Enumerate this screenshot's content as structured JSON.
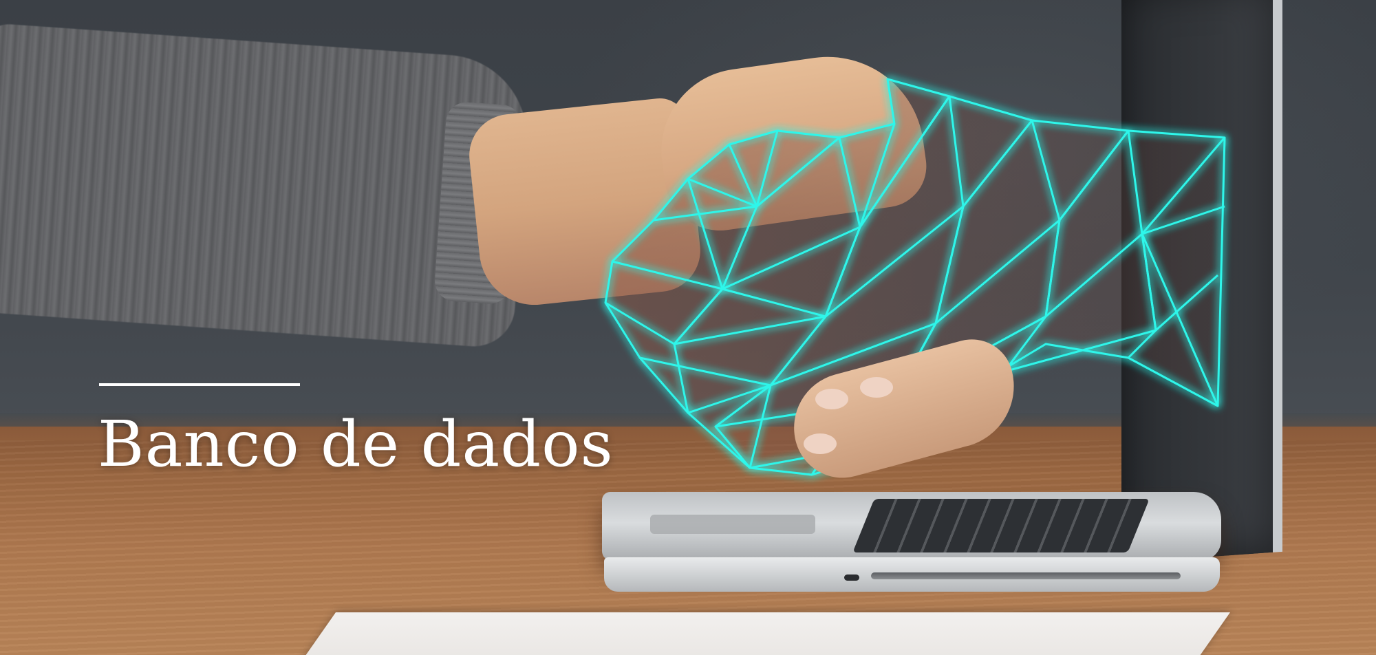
{
  "banner": {
    "title": "Banco de dados"
  },
  "colors": {
    "glow": "#2ff6ea",
    "title_text": "#ffffff",
    "wall": "#3d4248",
    "table_wood": "#a8734a",
    "sweater": "#646568"
  },
  "icons": {
    "hero_image": "handshake-human-robot-hand-laptop"
  }
}
